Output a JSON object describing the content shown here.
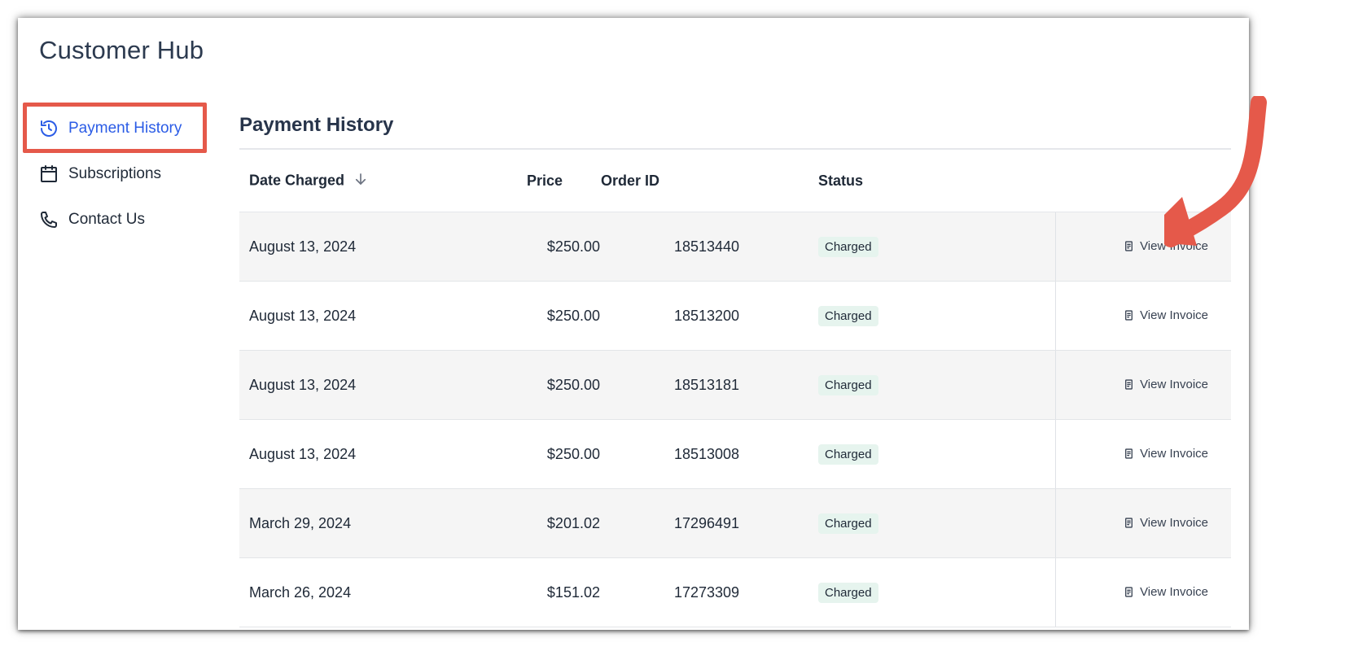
{
  "app": {
    "title": "Customer Hub"
  },
  "sidebar": {
    "items": [
      {
        "label": "Payment History",
        "icon": "history-icon",
        "active": true
      },
      {
        "label": "Subscriptions",
        "icon": "calendar-icon",
        "active": false
      },
      {
        "label": "Contact Us",
        "icon": "phone-icon",
        "active": false
      }
    ]
  },
  "main": {
    "title": "Payment History",
    "columns": {
      "date": "Date Charged",
      "price": "Price",
      "order": "Order ID",
      "status": "Status"
    },
    "rows": [
      {
        "date": "August 13, 2024",
        "price": "$250.00",
        "order": "18513440",
        "status": "Charged",
        "action": "View Invoice"
      },
      {
        "date": "August 13, 2024",
        "price": "$250.00",
        "order": "18513200",
        "status": "Charged",
        "action": "View Invoice"
      },
      {
        "date": "August 13, 2024",
        "price": "$250.00",
        "order": "18513181",
        "status": "Charged",
        "action": "View Invoice"
      },
      {
        "date": "August 13, 2024",
        "price": "$250.00",
        "order": "18513008",
        "status": "Charged",
        "action": "View Invoice"
      },
      {
        "date": "March 29, 2024",
        "price": "$201.02",
        "order": "17296491",
        "status": "Charged",
        "action": "View Invoice"
      },
      {
        "date": "March 26, 2024",
        "price": "$151.02",
        "order": "17273309",
        "status": "Charged",
        "action": "View Invoice"
      }
    ]
  },
  "colors": {
    "accent": "#2b5ce6",
    "annotation": "#e5594a",
    "badge_bg": "#e6f4ee",
    "row_alt": "#f5f5f5"
  }
}
